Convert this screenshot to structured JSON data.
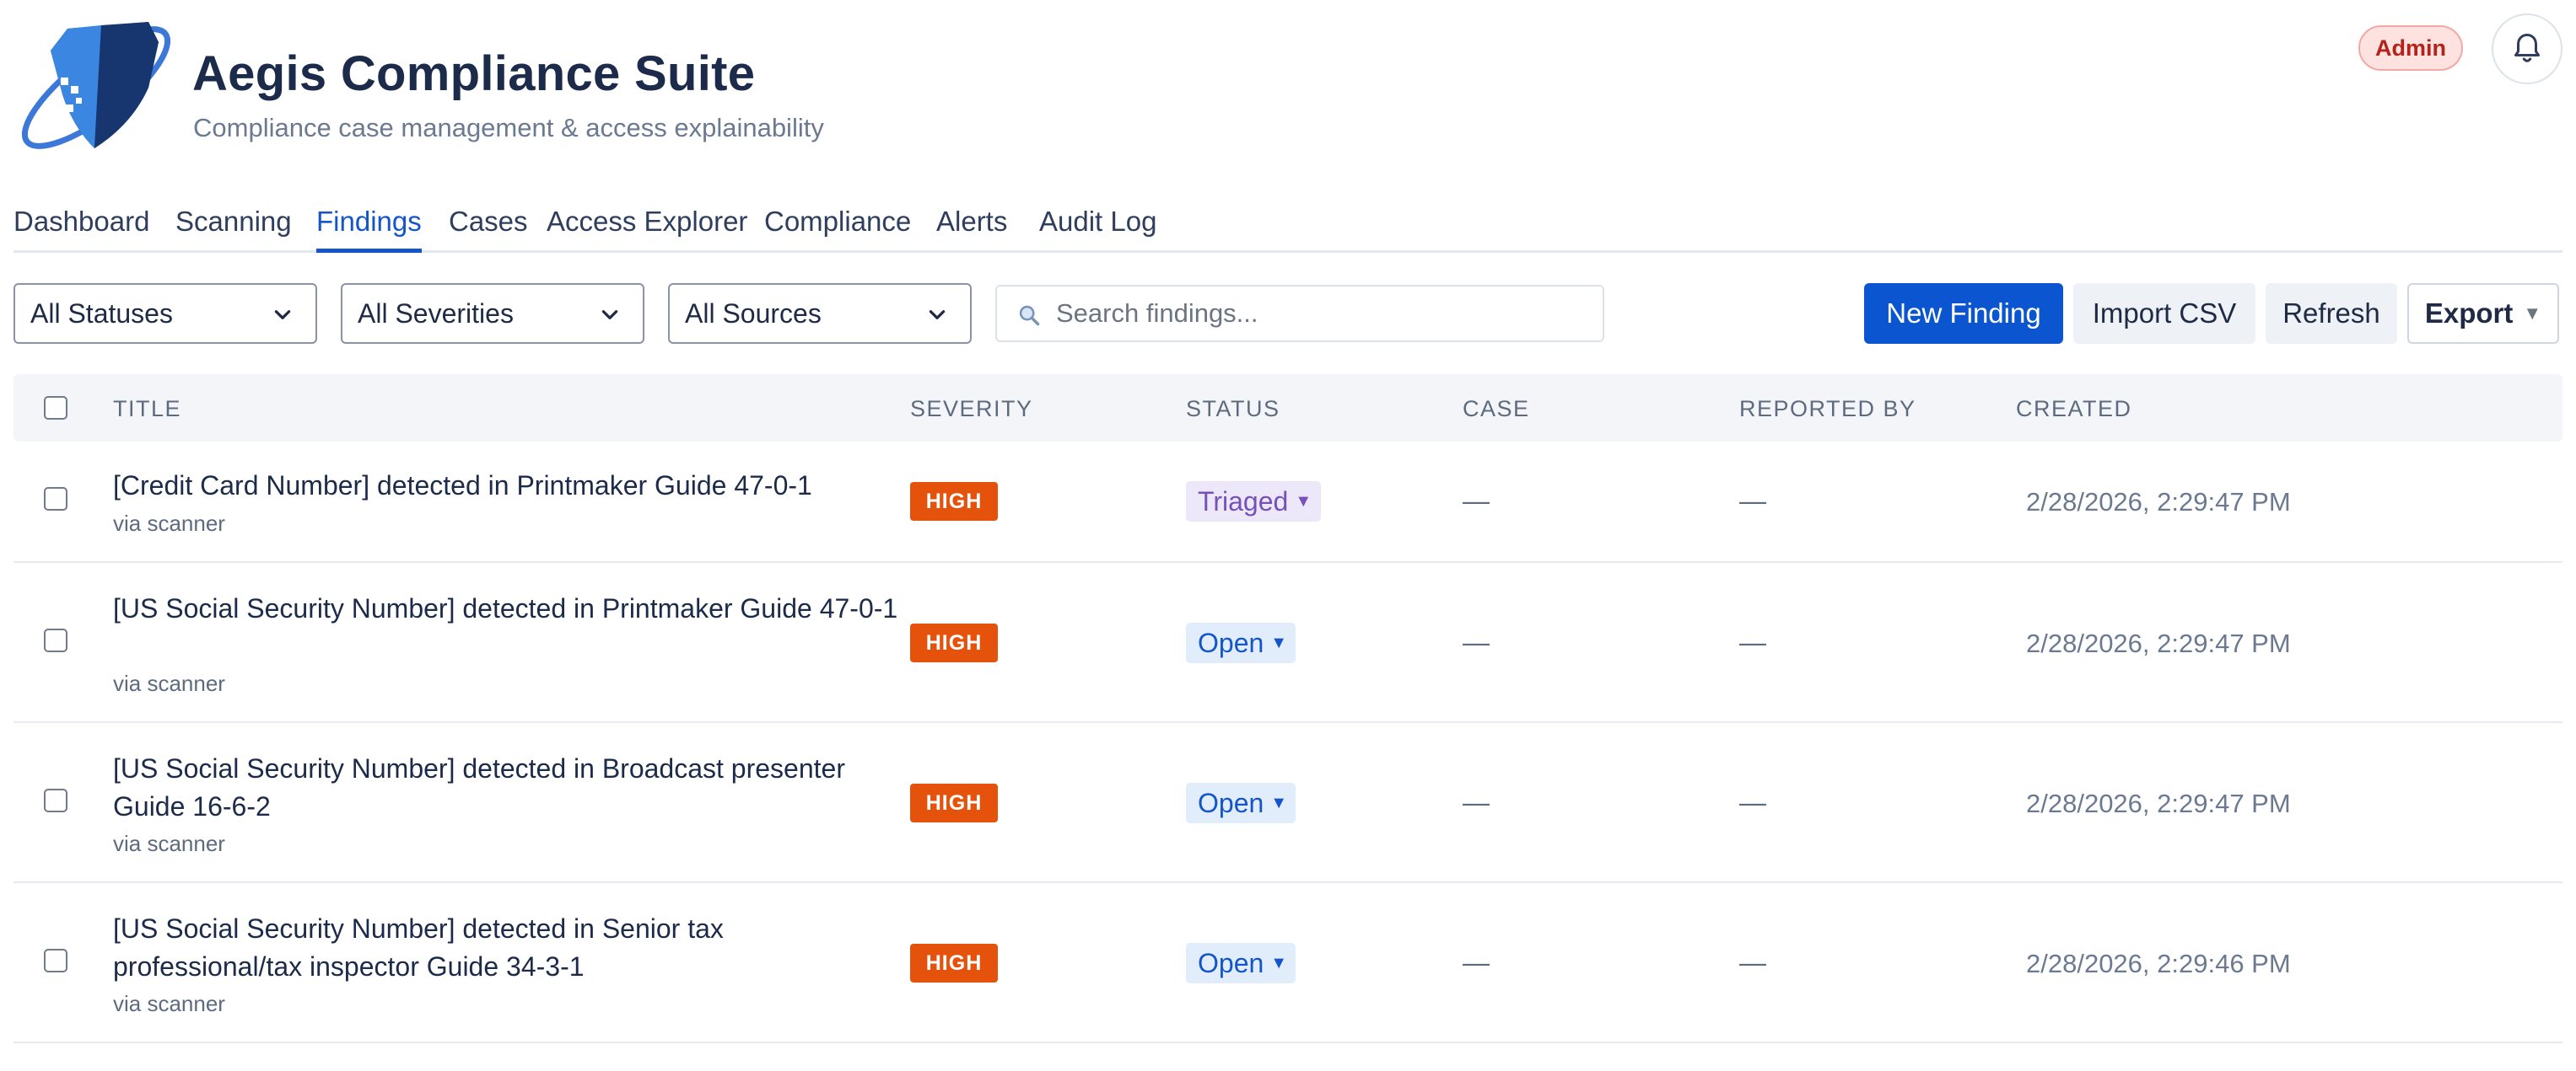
{
  "app": {
    "title": "Aegis Compliance Suite",
    "subtitle": "Compliance case management & access explainability",
    "role_badge": "Admin"
  },
  "icons": {
    "logo": "shield-logo-icon",
    "notifications": "bell-icon",
    "search": "search-icon",
    "dropdown": "chevron-down-icon"
  },
  "colors": {
    "accent": "#0b56d0",
    "severity_high": "#e4520b",
    "status_triaged": "#7551b8",
    "status_open": "#1456c9",
    "admin_badge": "#b4231b"
  },
  "tabs": [
    {
      "label": "Dashboard",
      "active": false
    },
    {
      "label": "Scanning",
      "active": false
    },
    {
      "label": "Findings",
      "active": true
    },
    {
      "label": "Cases",
      "active": false
    },
    {
      "label": "Access Explorer",
      "active": false
    },
    {
      "label": "Compliance",
      "active": false
    },
    {
      "label": "Alerts",
      "active": false
    },
    {
      "label": "Audit Log",
      "active": false
    }
  ],
  "filters": {
    "status": "All Statuses",
    "severity": "All Severities",
    "source": "All Sources",
    "search_placeholder": "Search findings..."
  },
  "actions": {
    "new": "New Finding",
    "import": "Import CSV",
    "refresh": "Refresh",
    "export": "Export"
  },
  "table": {
    "columns": [
      "TITLE",
      "SEVERITY",
      "STATUS",
      "CASE",
      "REPORTED BY",
      "CREATED"
    ],
    "rows": [
      {
        "title": "[Credit Card Number] detected in Printmaker Guide 47-0-1",
        "source": "via scanner",
        "severity": "HIGH",
        "status": "Triaged",
        "case": "—",
        "reported_by": "—",
        "created": "2/28/2026, 2:29:47 PM"
      },
      {
        "title": "[US Social Security Number] detected in Printmaker Guide 47-0-1",
        "source": "via scanner",
        "severity": "HIGH",
        "status": "Open",
        "case": "—",
        "reported_by": "—",
        "created": "2/28/2026, 2:29:47 PM"
      },
      {
        "title": "[US Social Security Number] detected in Broadcast presenter Guide 16-6-2",
        "source": "via scanner",
        "severity": "HIGH",
        "status": "Open",
        "case": "—",
        "reported_by": "—",
        "created": "2/28/2026, 2:29:47 PM"
      },
      {
        "title": "[US Social Security Number] detected in Senior tax professional/tax inspector Guide 34-3-1",
        "source": "via scanner",
        "severity": "HIGH",
        "status": "Open",
        "case": "—",
        "reported_by": "—",
        "created": "2/28/2026, 2:29:46 PM"
      }
    ]
  }
}
